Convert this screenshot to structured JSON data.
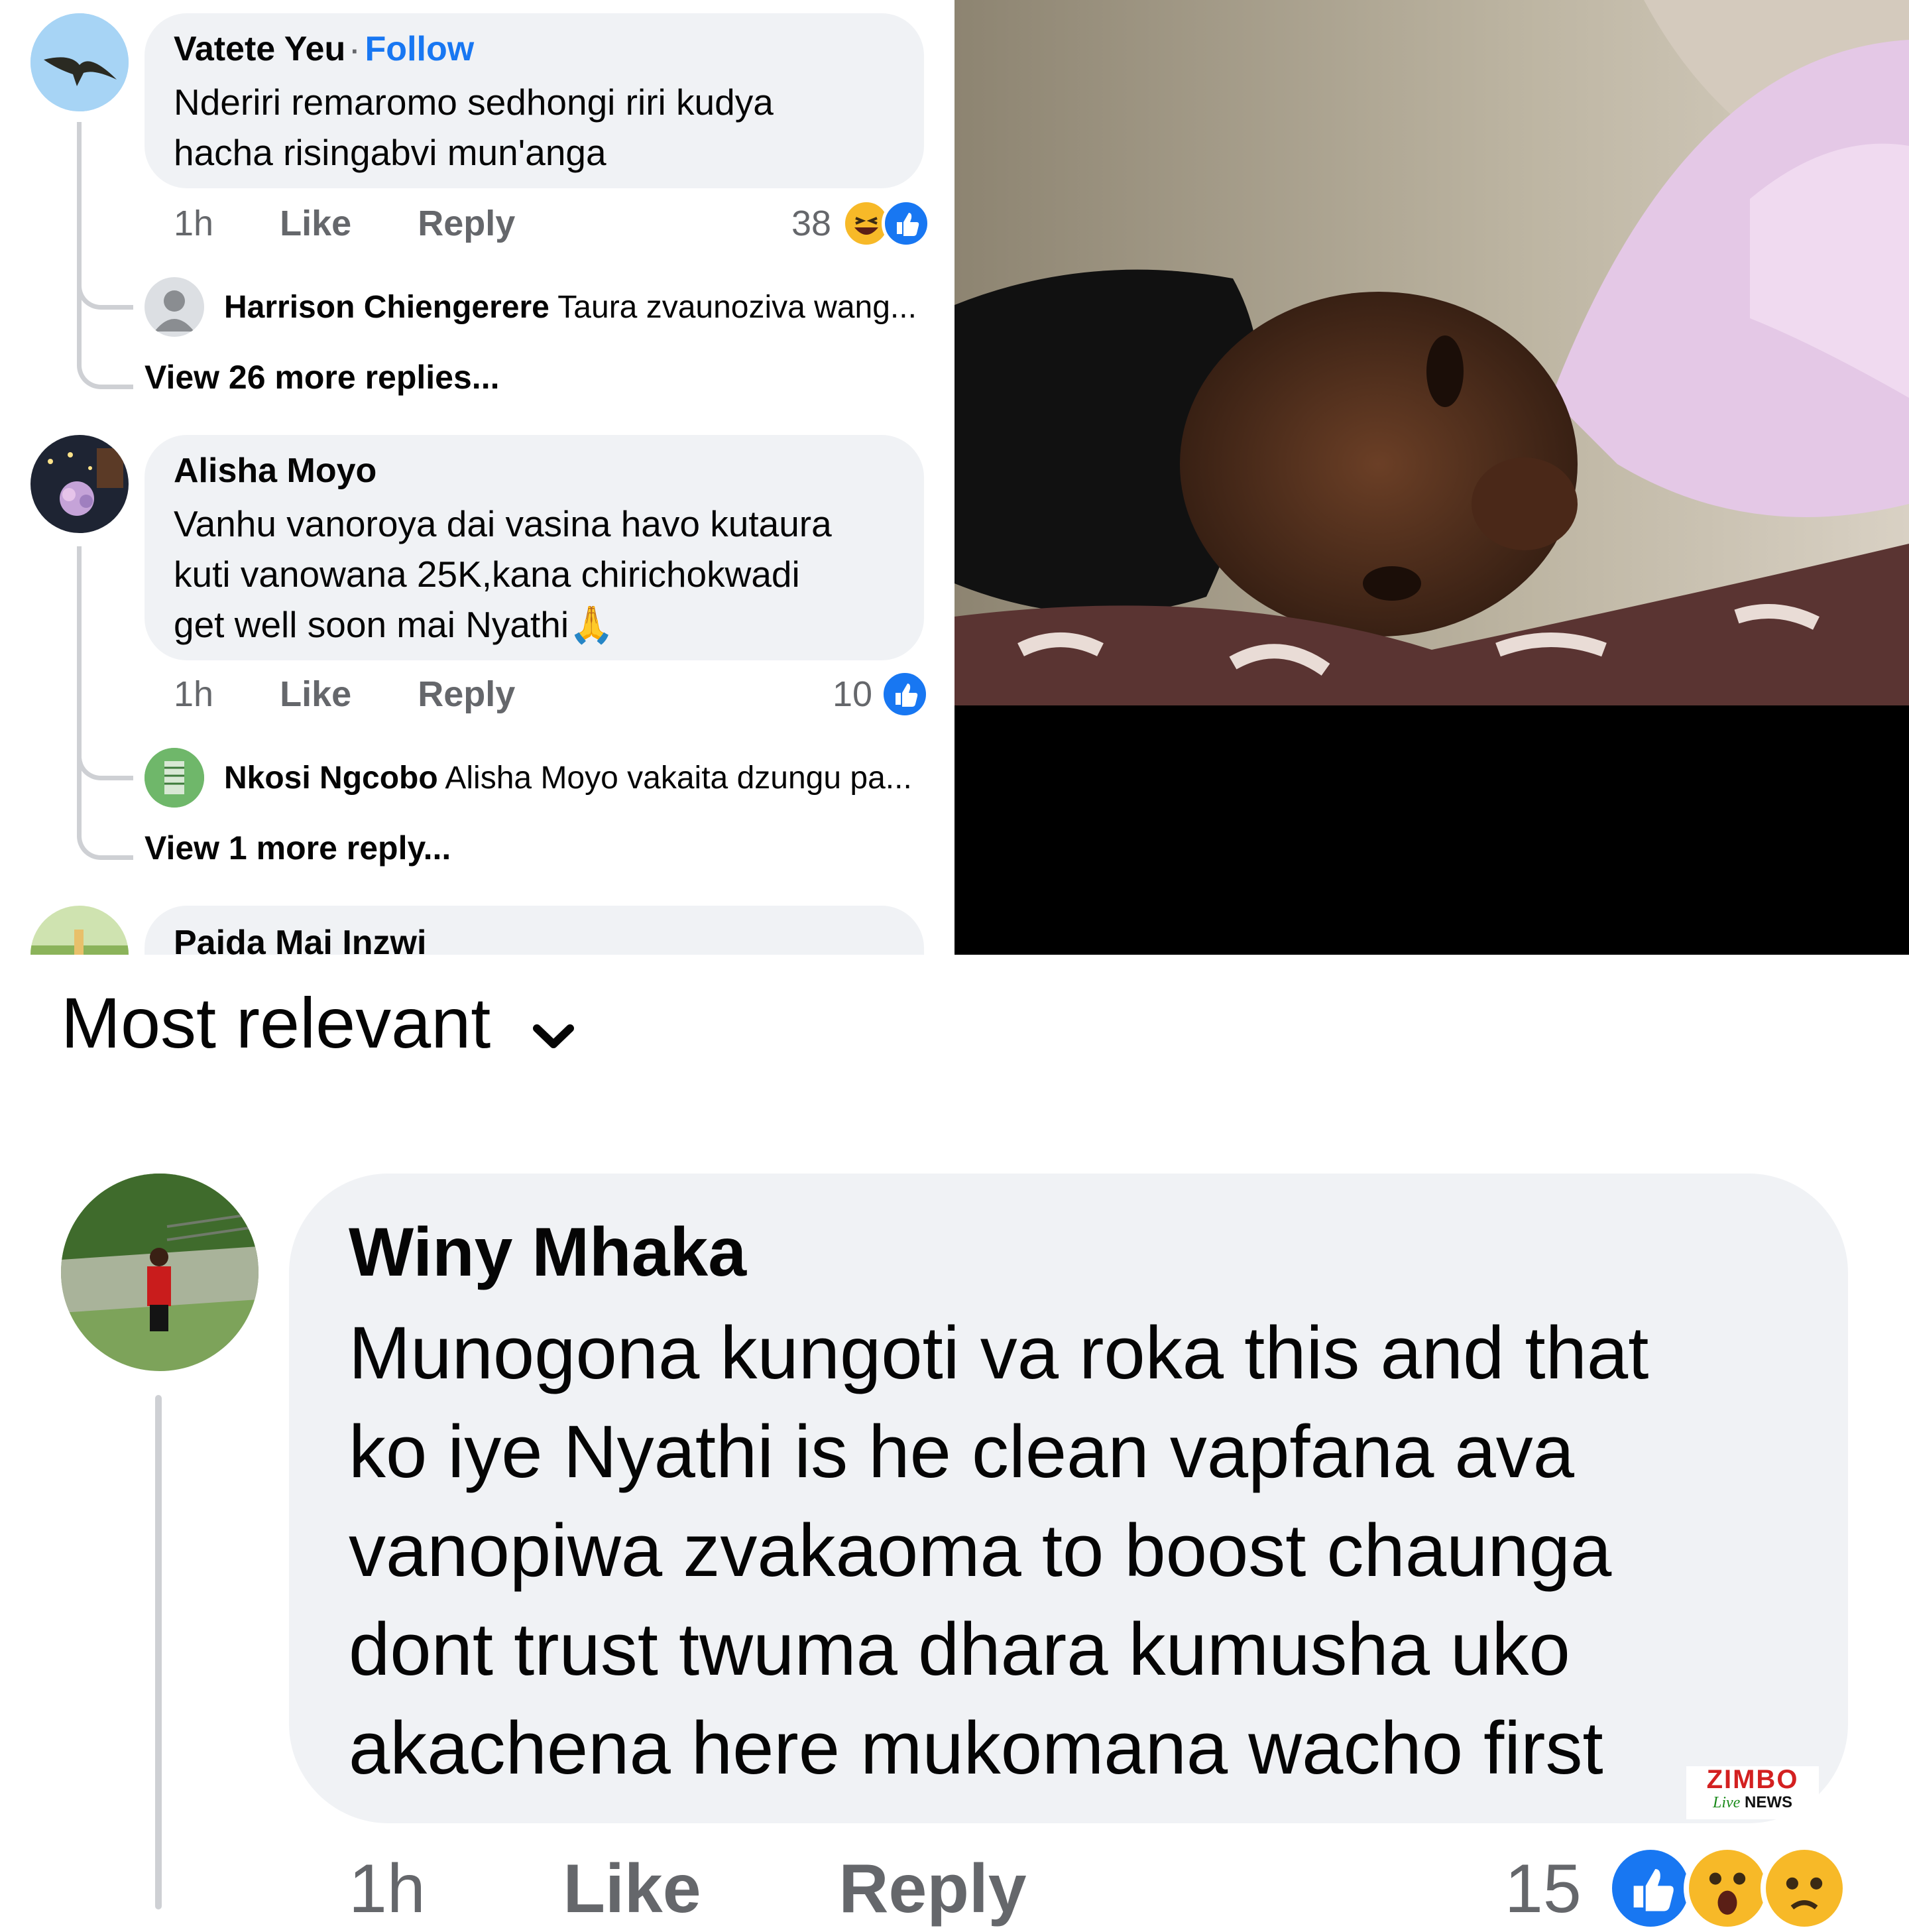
{
  "comments_top": [
    {
      "author": "Vatete Yeu",
      "follow_label": "Follow",
      "text_lines": [
        "Nderiri remaromo sedhongi riri kudya",
        "hacha risingabvi mun'anga"
      ],
      "time": "1h",
      "like_label": "Like",
      "reply_label": "Reply",
      "reaction_count": "38",
      "reactions": [
        "haha-icon",
        "like-icon"
      ],
      "reply_preview": {
        "author": "Harrison Chiengerere",
        "text": "Taura zvaunoziva wang..."
      },
      "view_more": "View 26 more replies..."
    },
    {
      "author": "Alisha Moyo",
      "text_lines": [
        "Vanhu vanoroya dai vasina havo kutaura",
        "kuti vanowana 25K,kana chirichokwadi",
        "get well soon mai Nyathi"
      ],
      "emoji": "🙏",
      "time": "1h",
      "like_label": "Like",
      "reply_label": "Reply",
      "reaction_count": "10",
      "reactions": [
        "like-icon"
      ],
      "reply_preview": {
        "author": "Nkosi Ngcobo",
        "text": "Alisha Moyo vakaita dzungu pa..."
      },
      "view_more": "View 1 more reply..."
    },
    {
      "author": "Paida Mai Inzwi"
    }
  ],
  "sort": {
    "label": "Most relevant",
    "icon": "chevron-down-icon"
  },
  "main_comment": {
    "author": "Winy Mhaka",
    "text_lines": [
      "Munogona kungoti va roka this and that",
      "ko iye Nyathi is he clean vapfana ava",
      "vanopiwa zvakaoma to boost chaunga",
      "dont trust twuma dhara kumusha uko",
      "akachena here mukomana wacho first"
    ],
    "time": "1h",
    "like_label": "Like",
    "reply_label": "Reply",
    "reaction_count": "15",
    "reactions": [
      "like-icon",
      "wow-icon",
      "sad-icon"
    ]
  },
  "watermark": {
    "brand": "ZIMBO",
    "sub1": "Live",
    "sub2": "NEWS"
  },
  "colors": {
    "accent": "#1877f2",
    "bubble": "#f0f2f5",
    "muted": "#65676b"
  }
}
